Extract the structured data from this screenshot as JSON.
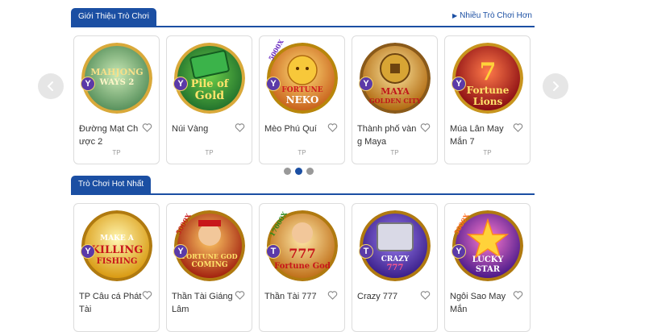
{
  "section1": {
    "title": "Giới Thiệu Trò Chơi",
    "more_link": "Nhiều Trò Chơi Hơn",
    "games": [
      {
        "name": "Đường Mạt Chược 2",
        "logo_line1": "MAHJONG",
        "logo_line2": "WAYS 2",
        "badge": "Y",
        "provider": "TP"
      },
      {
        "name": "Núi Vàng",
        "logo_line1": "Pile of",
        "logo_line2": "Gold",
        "badge": "Y",
        "provider": "TP"
      },
      {
        "name": "Mèo Phú Quí",
        "logo_line1": "FORTUNE",
        "logo_line2": "NEKO",
        "multiplier": "5000X",
        "badge": "Y",
        "provider": "TP"
      },
      {
        "name": "Thành phố vàng Maya",
        "logo_line1": "MAYA",
        "logo_line2": "GOLDEN CITY",
        "badge": "Y",
        "provider": "TP"
      },
      {
        "name": "Múa Lân May Mắn 7",
        "logo_line1": "Fortune",
        "logo_line2": "Lions",
        "badge": "Y",
        "provider": "TP"
      }
    ]
  },
  "section2": {
    "title": "Trò Chơi Hot Nhất",
    "games": [
      {
        "name": "TP Câu cá Phát Tài",
        "logo_line1": "MAKE A",
        "logo_line2": "KILLING",
        "logo_line3": "FISHING",
        "badge": "Y"
      },
      {
        "name": "Thần Tài Giáng Lâm",
        "logo_line1": "FORTUNE GOD",
        "logo_line2": "COMING",
        "multiplier": "5000X",
        "badge": "Y"
      },
      {
        "name": "Thần Tài 777",
        "logo_line1": "777",
        "logo_line2": "Fortune God",
        "multiplier": "17000X",
        "badge": "T"
      },
      {
        "name": "Crazy 777",
        "logo_line1": "CRAZY",
        "logo_line2": "777",
        "badge": "T"
      },
      {
        "name": "Ngôi Sao May Mắn",
        "logo_line1": "LUCKY",
        "logo_line2": "STAR",
        "multiplier": "5000X",
        "badge": "Y"
      }
    ]
  },
  "carousel": {
    "page_count": 3,
    "active_page": 2
  },
  "icons": {
    "prev": "chevron-left-icon",
    "next": "chevron-right-icon",
    "favorite": "heart-outline-icon",
    "more": "triangle-right-icon"
  },
  "colors": {
    "accent": "#1b4fa3",
    "badge": "#5b3aa8"
  }
}
